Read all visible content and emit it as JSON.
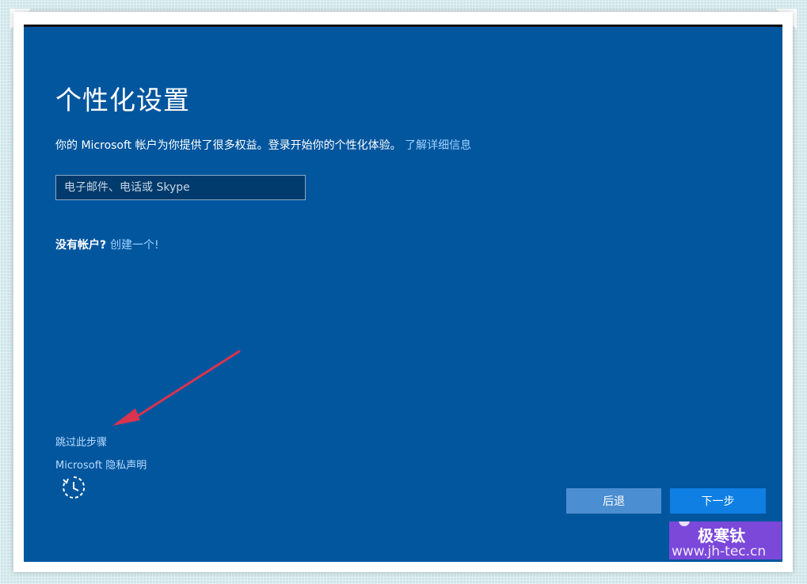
{
  "page": {
    "title": "个性化设置",
    "description": "你的 Microsoft 帐户为你提供了很多权益。登录开始你的个性化体验。",
    "learn_more_link": "了解详细信息",
    "email_placeholder": "电子邮件、电话或 Skype",
    "no_account_label": "没有帐户?",
    "create_account_link": "创建一个!",
    "skip_link": "跳过此步骤",
    "privacy_link": "Microsoft 隐私声明",
    "accessibility_icon": "ease-of-access-icon"
  },
  "buttons": {
    "back": "后退",
    "next": "下一步"
  },
  "annotation": {
    "arrow_icon": "red-arrow",
    "arrow_color": "#d9344f"
  },
  "watermark": {
    "name": "极寒钛",
    "url": "www.jh-tec.cn"
  },
  "colors": {
    "screen_bg": "#02569e",
    "input_bg": "#013a6c",
    "back_button": "#4b8ed1",
    "next_button": "#0f7fe4",
    "link": "#9fd2ff"
  }
}
